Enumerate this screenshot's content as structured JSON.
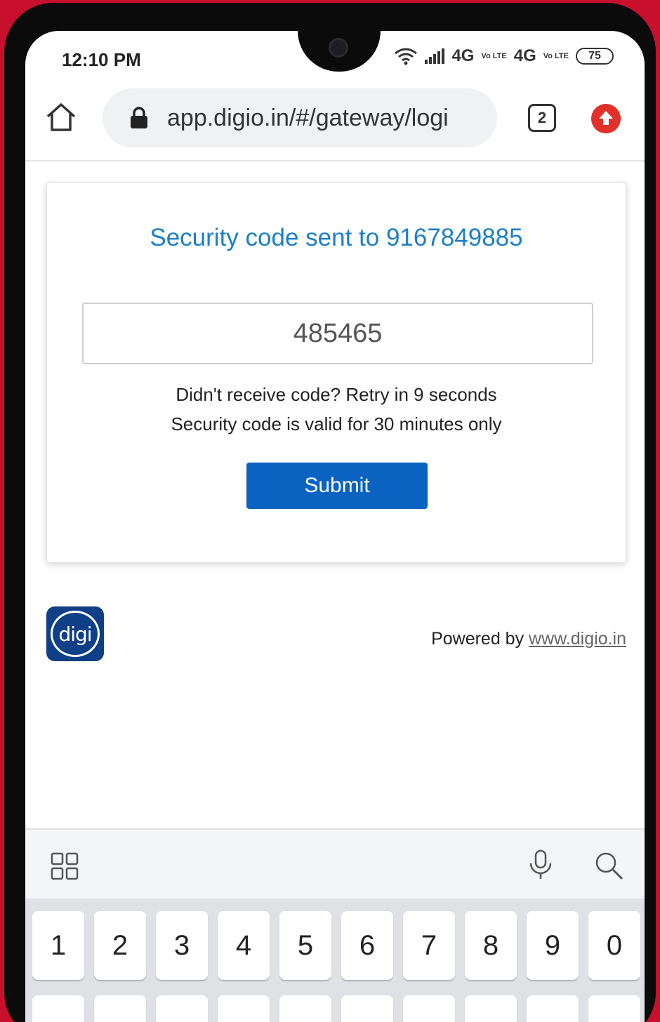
{
  "status_bar": {
    "time": "12:10 PM",
    "network1": "4G",
    "network2": "4G",
    "volte_label": "Vo LTE",
    "battery": "75"
  },
  "browser": {
    "url": "app.digio.in/#/gateway/logi",
    "tab_count": "2"
  },
  "card": {
    "title": "Security code sent to 9167849885",
    "otp_value": "485465",
    "retry_text": "Didn't receive code? Retry in 9 seconds",
    "valid_text": "Security code is valid for 30 minutes only",
    "submit_label": "Submit"
  },
  "footer": {
    "logo_text": "digi",
    "powered_by": "Powered by",
    "powered_link": "www.digio.in"
  },
  "keyboard": {
    "number_keys": [
      "1",
      "2",
      "3",
      "4",
      "5",
      "6",
      "7",
      "8",
      "9",
      "0"
    ]
  },
  "colors": {
    "accent_blue": "#1b7fc9",
    "button_blue": "#0a63c0",
    "background_red": "#c8102e",
    "logo_navy": "#0f3f86"
  }
}
